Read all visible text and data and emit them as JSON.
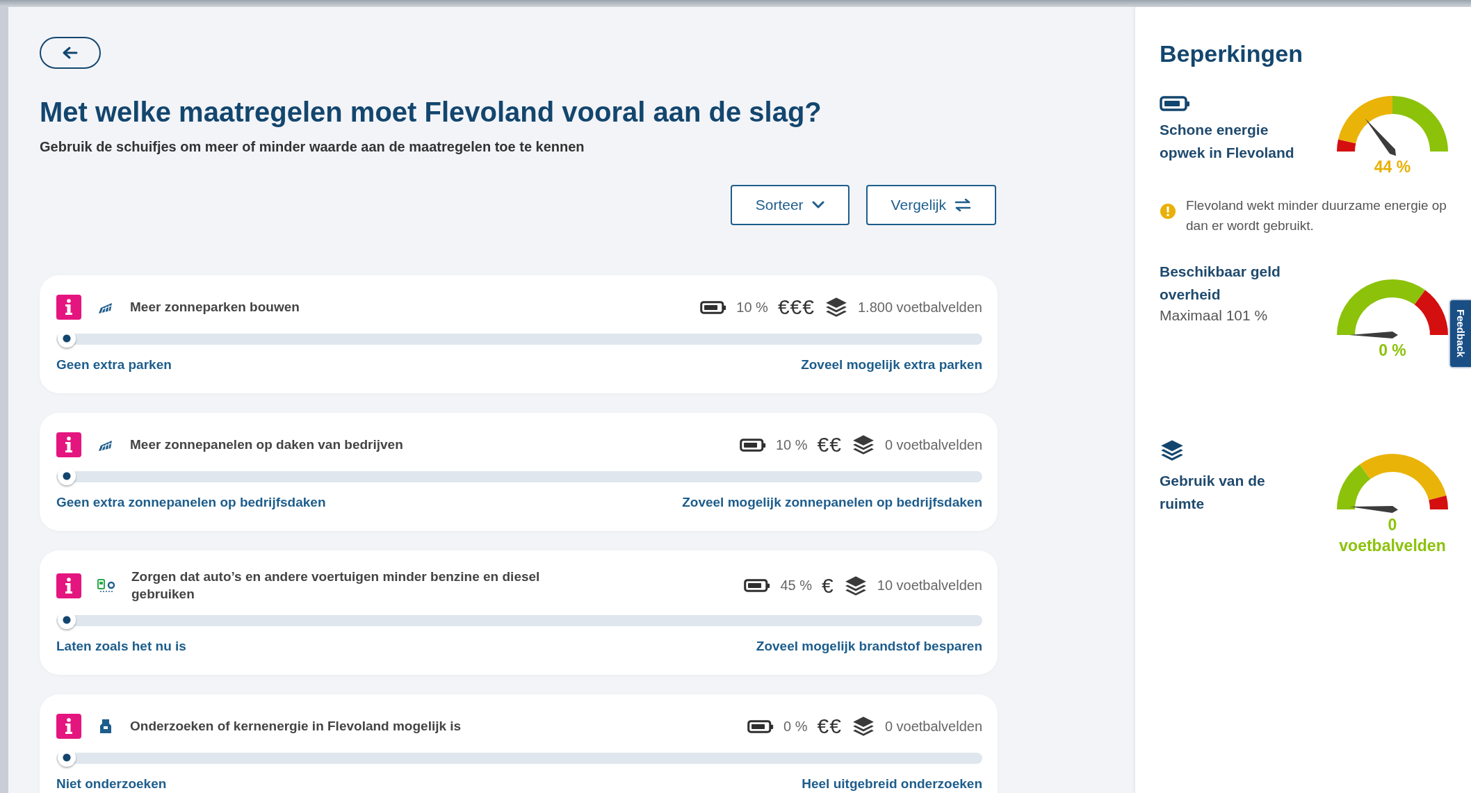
{
  "title": "Met welke maatregelen moet Flevoland vooral aan de slag?",
  "subtitle": "Gebruik de schuifjes om meer of minder waarde aan de maatregelen toe te kennen",
  "toolbar": [
    {
      "label": "Sorteer",
      "kind": "chevron"
    },
    {
      "label": "Vergelijk",
      "kind": "swap"
    }
  ],
  "measures": [
    {
      "kind": "solar",
      "title": "Meer zonneparken bouwen",
      "energy": "10 %",
      "cost": "€€€",
      "space": "1.800 voetbalvelden",
      "level": 0,
      "min_label": "Geen extra parken",
      "max_label": "Zoveel mogelijk extra parken"
    },
    {
      "kind": "solar",
      "title": "Meer zonnepanelen op daken van bedrijven",
      "energy": "10 %",
      "cost": "€€",
      "space": "0 voetbalvelden",
      "level": 0,
      "min_label": "Geen extra zonnepanelen op bedrijfsdaken",
      "max_label": "Zoveel mogelijk zonnepanelen op bedrijfsdaken"
    },
    {
      "kind": "car",
      "title": "Zorgen dat auto’s en andere voertuigen minder benzine en diesel gebruiken",
      "energy": "45 %",
      "cost": "€",
      "space": "10 voetbalvelden",
      "level": 0,
      "min_label": "Laten zoals het nu is",
      "max_label": "Zoveel mogelijk brandstof besparen"
    },
    {
      "kind": "nuclear",
      "title": "Onderzoeken of kernenergie in Flevoland mogelijk is",
      "energy": "0 %",
      "cost": "€€",
      "space": "0 voetbalvelden",
      "level": 0,
      "min_label": "Niet onderzoeken",
      "max_label": "Heel uitgebreid onderzoeken"
    }
  ],
  "constraints": {
    "title": "Beperkingen",
    "items": [
      {
        "kind": "battery",
        "title": "Schone energie opwek in Flevoland",
        "reading": "44 %",
        "color": "#e8b000",
        "warning": "Flevoland wekt minder duurzame energie op dan er wordt gebruikt."
      },
      {
        "kind": "money",
        "title": "Beschikbaar geld overheid",
        "note": "Maximaal  101 %",
        "reading": "0 %",
        "color": "#8cc20a"
      },
      {
        "kind": "layers",
        "title": "Gebruik van de ruimte",
        "reading": "0 voetbalvelden",
        "color": "#8cc20a"
      }
    ]
  },
  "feedback_tab": {
    "label": "Feedback"
  }
}
